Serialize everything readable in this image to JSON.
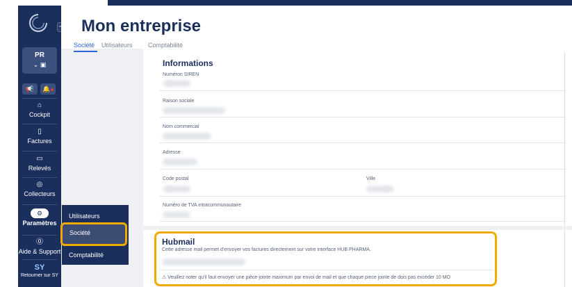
{
  "header": {
    "title": "Mon entreprise"
  },
  "tabs": [
    {
      "label": "Société",
      "active": true
    },
    {
      "label": "Utilisateurs",
      "active": false
    },
    {
      "label": "Comptabilité",
      "active": false
    }
  ],
  "sidebar": {
    "user_initials": "PR",
    "items": [
      {
        "label": "Cockpit",
        "icon": "home-icon"
      },
      {
        "label": "Factures",
        "icon": "document-icon"
      },
      {
        "label": "Relevés",
        "icon": "folder-icon"
      },
      {
        "label": "Collecteurs",
        "icon": "collector-icon"
      },
      {
        "label": "Paramètres",
        "icon": "gear-icon"
      },
      {
        "label": "Aide & Support",
        "icon": "help-icon"
      },
      {
        "label": "Retourner sur SY",
        "icon": "sy-logo-icon"
      }
    ]
  },
  "flyout": {
    "items": [
      {
        "label": "Utilisateurs"
      },
      {
        "label": "Société",
        "active": true
      },
      {
        "label": "Comptabilité"
      }
    ]
  },
  "informations": {
    "title": "Informations",
    "fields": {
      "siren": "Numéron SIREN",
      "raison": "Raison sociale",
      "nom": "Nom commercial",
      "adresse": "Adresse",
      "cp": "Code postal",
      "ville": "Ville",
      "tva": "Numéro de TVA intracommunautaire"
    }
  },
  "hubmail": {
    "title": "Hubmail",
    "description": "Cette adresse mail permet d'envoyer vos factures directement sur votre interface HUB PHARMA.",
    "warning": "⚠ Veuillez noter qu'il faut envoyer une pièce-jointe maximum par envoi de mail et que chaque piece jointe de dois pas excéder 10 MO"
  },
  "colors": {
    "navy": "#1b2f5c",
    "accent": "#f2a900",
    "link": "#2d63d8"
  }
}
